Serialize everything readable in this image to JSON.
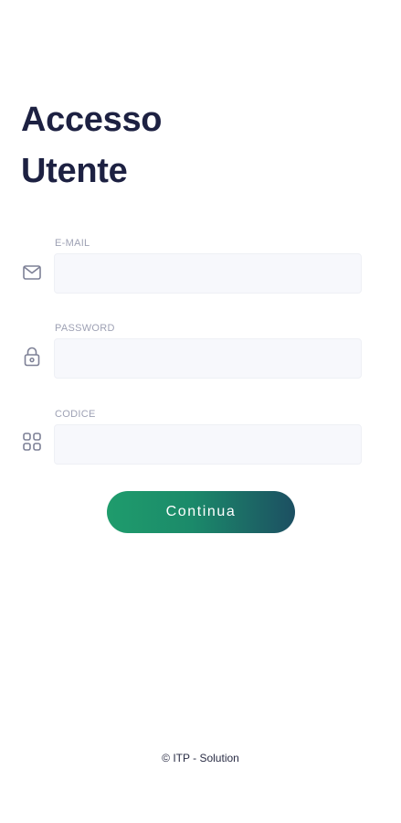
{
  "page": {
    "title_line1": "Accesso",
    "title_line2": "Utente"
  },
  "form": {
    "email": {
      "label": "E-MAIL",
      "value": "",
      "icon": "mail-icon"
    },
    "password": {
      "label": "PASSWORD",
      "value": "",
      "icon": "lock-icon"
    },
    "code": {
      "label": "CODICE",
      "value": "",
      "icon": "grid-icon"
    },
    "submit_label": "Continua"
  },
  "footer": {
    "copyright": "© ITP - Solution"
  },
  "colors": {
    "title": "#1d2142",
    "label": "#9ea1b4",
    "input_bg": "#f7f8fc",
    "icon": "#7d8096",
    "button_start": "#1f9c6c",
    "button_end": "#1c4f62"
  }
}
